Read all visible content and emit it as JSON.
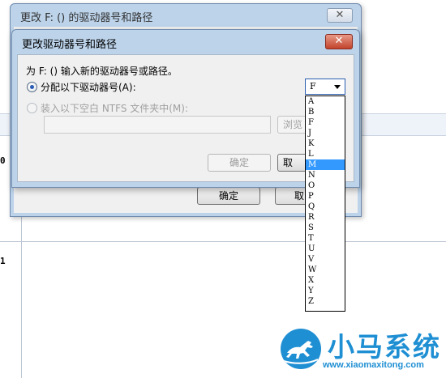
{
  "background": {
    "row_labels": [
      "0",
      "1"
    ],
    "buttons": [
      "确定",
      "取"
    ]
  },
  "outer_dialog": {
    "title": "更改 F: () 的驱动器号和路径",
    "close_glyph": "✕"
  },
  "dialog": {
    "title": "更改驱动器号和路径",
    "close_glyph": "✕",
    "prompt": "为 F: () 输入新的驱动器号或路径。",
    "option_assign": "分配以下驱动器号(A):",
    "option_mount": "装入以下空白 NTFS 文件夹中(M):",
    "path_value": "",
    "browse_label": "浏览",
    "ok_label": "确定",
    "cancel_label": "取"
  },
  "drive_select": {
    "selected": "F",
    "options": [
      "A",
      "B",
      "F",
      "J",
      "K",
      "L",
      "M",
      "N",
      "O",
      "P",
      "Q",
      "R",
      "S",
      "T",
      "U",
      "V",
      "W",
      "X",
      "Y",
      "Z"
    ],
    "highlighted": "M"
  },
  "watermark": {
    "title": "小马系统",
    "url": "www.xiaomaxitong.com",
    "color": "#1f8fd3"
  },
  "colors": {
    "title_bar": "#bcd3ea",
    "close_red": "#c2432c",
    "highlight": "#3399ff"
  }
}
